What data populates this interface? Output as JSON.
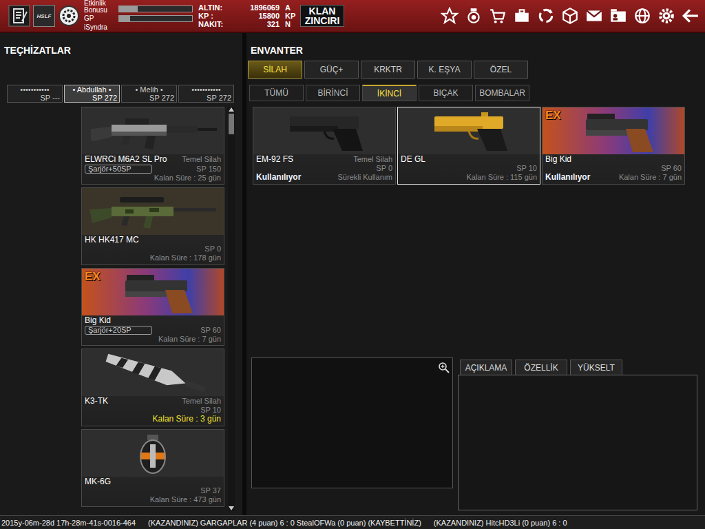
{
  "top_bar": {
    "clan_logo": "HSLF",
    "bonus_label": "Etkinlik Bonusu",
    "bonus_level": 0.25,
    "gp_label": "GP",
    "gp_level": 0.15,
    "username": "iSyndra",
    "currencies": [
      {
        "label": "ALTIN:",
        "value": "1896069",
        "unit": "A"
      },
      {
        "label": "KP :",
        "value": "15800",
        "unit": "KP"
      },
      {
        "label": "NAKIT:",
        "value": "321",
        "unit": "N"
      }
    ],
    "clan_button": "KLAN ZINCIRI"
  },
  "equipment": {
    "title": "TEÇHİZATLAR",
    "characters": [
      {
        "name": "•••••••••••",
        "sp": "SP ---",
        "selected": false
      },
      {
        "name": "• Abdullah •",
        "sp": "SP 272",
        "selected": true
      },
      {
        "name": "• Melih •",
        "sp": "SP 272",
        "selected": false
      },
      {
        "name": "•••••••••••",
        "sp": "SP 272",
        "selected": false
      }
    ],
    "items": [
      {
        "name": "ELWRCi M6A2 SL Pro",
        "type": "Temel Silah",
        "badge": "Şarjör+50SP",
        "sp": "SP 150",
        "remaining": "Kalan Süre : 25 gün",
        "warning": false,
        "kind": "rifle"
      },
      {
        "name": "HK HK417 MC",
        "sp": "SP 0",
        "remaining": "Kalan Süre : 178 gün",
        "warning": false,
        "kind": "sniper"
      },
      {
        "name": "Big Kid",
        "tag": "EX",
        "badge": "Şarjör+20SP",
        "sp": "SP 60",
        "remaining": "Kalan Süre : 7 gün",
        "warning": false,
        "kind": "ex-pistol"
      },
      {
        "name": "K3-TK",
        "type": "Temel Silah",
        "sp": "SP 10",
        "remaining": "Kalan Süre : 3 gün",
        "warning": true,
        "kind": "knife"
      },
      {
        "name": "MK-6G",
        "sp": "SP 37",
        "remaining": "Kalan Süre : 473 gün",
        "warning": false,
        "kind": "grenade"
      }
    ]
  },
  "inventory": {
    "title": "ENVANTER",
    "tabs": [
      {
        "label": "SİLAH",
        "selected": true
      },
      {
        "label": "GÜÇ+",
        "selected": false
      },
      {
        "label": "KRKTR",
        "selected": false
      },
      {
        "label": "K. EŞYA",
        "selected": false
      },
      {
        "label": "ÖZEL",
        "selected": false
      }
    ],
    "subtabs": [
      {
        "label": "TÜMÜ",
        "selected": false
      },
      {
        "label": "BİRİNCİ",
        "selected": false
      },
      {
        "label": "İKİNCİ",
        "selected": true
      },
      {
        "label": "BIÇAK",
        "selected": false
      },
      {
        "label": "BOMBALAR",
        "selected": false
      }
    ],
    "items": [
      {
        "name": "EM-92 FS",
        "type": "Temel Silah",
        "sp": "SP 0",
        "status": "Kullanılıyor",
        "remaining": "Sürekli Kullanım",
        "warning": false,
        "kind": "pistol",
        "selected": false
      },
      {
        "name": "DE GL",
        "sp": "SP 10",
        "remaining": "Kalan Süre : 115 gün",
        "warning": false,
        "kind": "gold-pistol",
        "selected": true
      },
      {
        "name": "Big Kid",
        "tag": "EX",
        "sp": "SP 60",
        "status": "Kullanılıyor",
        "remaining": "Kalan Süre : 7 gün",
        "warning": false,
        "kind": "ex-pistol",
        "selected": false
      }
    ]
  },
  "details": {
    "tabs": [
      {
        "label": "AÇIKLAMA",
        "selected": false
      },
      {
        "label": "ÖZELLİK",
        "selected": false
      },
      {
        "label": "YÜKSELT",
        "selected": false
      }
    ]
  },
  "ticker": {
    "timestamp": "2015y-06m-28d 17h-28m-41s-0016-464",
    "messages": [
      "(KAZANDINIZ) GARGAPLAR (4 puan) 6 : 0 StealOFWa (0 puan) (KAYBETTİNİZ)",
      "(KAZANDINIZ) HitcHD3Li (0 puan) 6 : 0"
    ]
  }
}
